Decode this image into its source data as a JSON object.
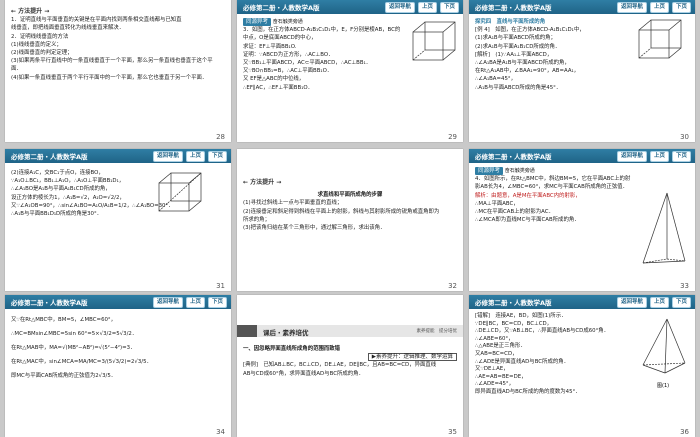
{
  "header": {
    "title": "必修第二册・人教数学A版",
    "btn_nav": "返回导航",
    "btn_prev": "上页",
    "btn_next": "下页"
  },
  "slides": [
    {
      "page": "28",
      "heading": "方法提升",
      "lines": [
        "1．证明直线与平面垂直的关键是在平面内找到两条相交直线都与已知直",
        "线垂直，即把线面垂直转化为线线垂直来解决．",
        "2．证明线线垂直的方法",
        "(1)线线垂直的定义；",
        "(2)线面垂直的判定定理；",
        "(3)如果两条平行直线中的一条直线垂直于一个平面，那么另一条直线也垂直于这个平",
        "面．",
        "(4)如果一条直线垂直于两个平行平面中的一个平面，那么它也垂直于另一个平面．"
      ]
    },
    {
      "page": "29",
      "tag": "同源异考",
      "tag_note": "奋石触类旁通",
      "lines": [
        "3．如图，在正方体ABCD-A₁B₁C₁D₁中，E，F分别是棱AB，BC的",
        "中点，O是底面ABCD的中心，",
        "求证：EF⊥平面BB₁O.",
        "证明：∵ABCD为正方形，∴AC⊥BO．",
        "又∵BB₁⊥平面ABCD，AC⊂平面ABCD，∴AC⊥BB₁．",
        "又∵BO∩BB₁=B，∴AC⊥平面BB₁O．",
        "又 EF是△ABC的中位线，",
        "∴EF∥AC，∴EF⊥平面BB₁O．"
      ]
    },
    {
      "page": "30",
      "heading": "探究四",
      "lines": [
        "探究四　直线与平面所成的角",
        "[例 4]　如图，在正方体ABCD-A₁B₁C₁D₁中，",
        "(1)求A₁B与平面ABCD所成的角；",
        "(2)求A₁B与平面A₁B₁CD所成的角．",
        "[解析]　(1)∵AA₁⊥平面ABCD，",
        "∴∠A₁BA是A₁B与平面ABCD所成的角，",
        "在Rt△A₁AB中，∠BAA₁=90°，AB=AA₁，",
        "∴∠A₁BA=45°，",
        "∴A₁B与平面ABCD所成的角是45°．"
      ]
    },
    {
      "page": "31",
      "lines": [
        "(2)连接A₁C，交BC₁于点O，连接BO，",
        "∵A₁O⊥BC₁，BB₁⊥A₁O，∴A₁O⊥平面BB₁D₁，",
        "∴∠A₁BO是A₁B与平面A₁B₁CD所成的角，",
        "设正方体的棱长为1，∴A₁B=√2，A₁O=√2/2，",
        "又∵∠A₁OB=90°，∴sin∠A₁BO=A₁O/A₁B=1/2，∴∠A₁BO=30°．",
        "∴A₁B与平面BB₁D₁D所成的角是30°．"
      ]
    },
    {
      "page": "32",
      "heading": "方法提升",
      "lines": [
        "求直线和平面所成角的步骤",
        "(1)寻找过斜线上一点与平面垂直的直线；",
        "(2)连接垂足和斜足得到斜线在平面上的射影，斜线与其射影所成的锐角或直角即为",
        "所求的角；",
        "(3)把该角归结在某个三角形中，通过解三角形，求出该角．"
      ]
    },
    {
      "page": "33",
      "tag": "同源异考",
      "tag_note": "奋石触类旁通",
      "lines": [
        "4．如图所示，在Rt△BMC中，斜边BM=5，它在平面ABC上的射",
        "影AB长为4，∠MBC=60°，求MC与平面CAB所成角的正弦值．",
        "",
        "解析：由题意，A是M在平面ABC内的射影，",
        "∴MA⊥平面ABC，",
        "∴MC在平面CAB上的射影为AC．",
        "∴∠MCA即为直线MC与平面CAB所成的角．"
      ]
    },
    {
      "page": "34",
      "lines": [
        "又∵在Rt△MBC中，BM=5，∠MBC=60°，",
        "∴MC=BMsin∠MBC=5sin 60°=5×√3/2=5√3/2．",
        "在Rt△MAB中，MA=√(MB²−AB²)=√(5²−4²)=3．",
        "在Rt△MAC中，sin∠MCA=MA/MC=3/(5√3/2)=2√3/5．",
        "即MC与平面CAB所成角的正弦值为2√3/5．"
      ]
    },
    {
      "page": "35",
      "band": "课后・素养培优",
      "band_note": "素养提能　提分培优",
      "lines": [
        "一、因忽略异面直线所成角的范围而致错",
        "▶素养提升：逻辑推理、数学运算",
        "[典例]　已知AB⊥BC，BC⊥CD，DE⊥AE，DE∥BC，且AB=BC=CD，异面直线",
        "AB与CD成60°角，求异面直线AD与BC所成的角．"
      ]
    },
    {
      "page": "36",
      "lines": [
        "[错解]　连接AE，BD，如图(1)所示．",
        "∵DE∥BC，BC=CD，BC⊥CD，",
        "∴DE⊥CD，又∵AB⊥BC，∴异面直线AB与CD成60°角．",
        "∴∠ABE=60°，",
        "∴△ABE是正三角形．",
        "又AB=BC=CD，",
        "∴∠ADE是异面直线AD与BC所成的角．",
        "又∵DE⊥AE，",
        "∴AE=AB=BE=DE，",
        "∴∠ADE=45°，",
        "即异面直线AD与BC所成的角的度数为45°．"
      ],
      "figure_label": "图(1)"
    }
  ]
}
